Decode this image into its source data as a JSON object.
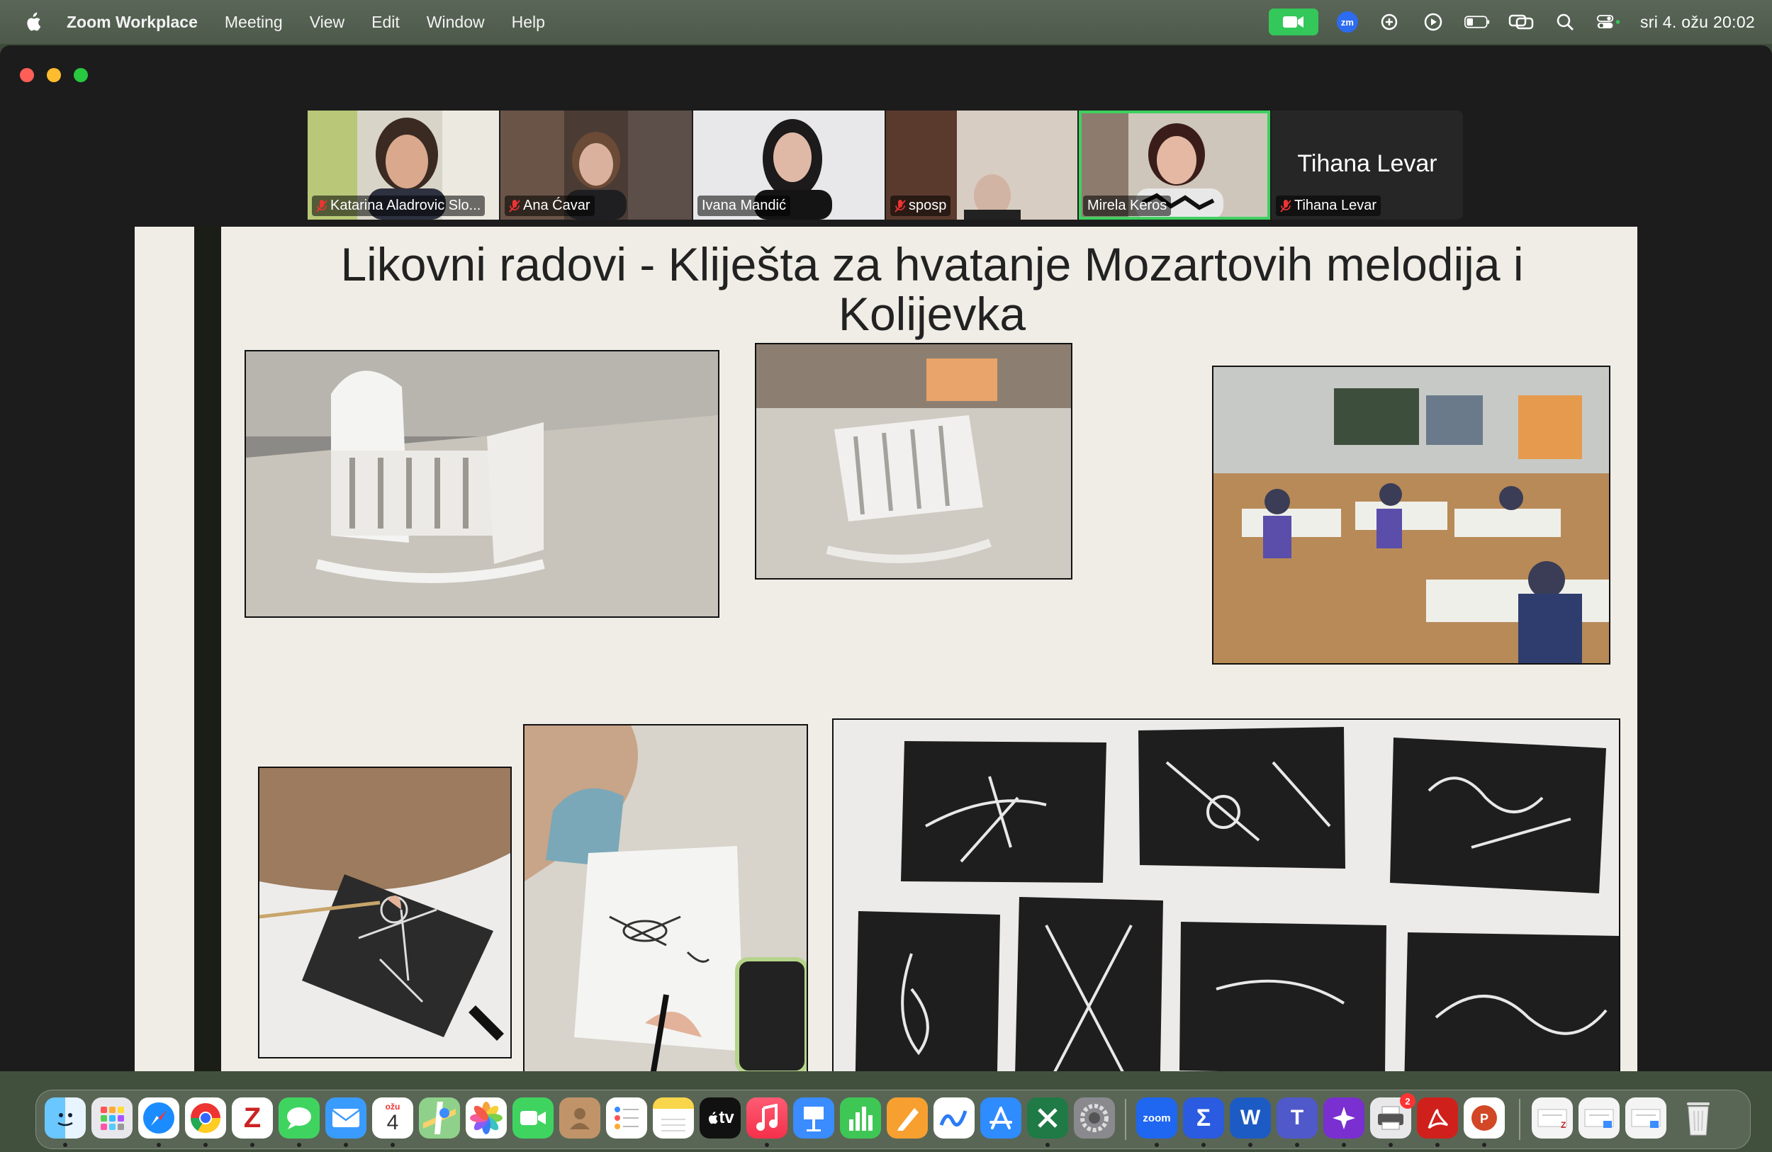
{
  "menubar": {
    "app_name": "Zoom Workplace",
    "items": [
      "Meeting",
      "View",
      "Edit",
      "Window",
      "Help"
    ],
    "clock": "sri 4. ožu  20:02",
    "zoom_badge": "zm",
    "status_icons": [
      "zoom-camera-icon",
      "zoom-app-icon",
      "spotlight-cloud-icon",
      "play-icon",
      "battery-icon",
      "screen-mirroring-icon",
      "search-icon",
      "control-center-icon"
    ]
  },
  "window": {
    "accent": "#3fd060"
  },
  "participants": [
    {
      "name": "Katarina Aladrovic Slo...",
      "muted": true,
      "has_video": true
    },
    {
      "name": "Ana Ćavar",
      "muted": true,
      "has_video": true
    },
    {
      "name": "Ivana Mandić",
      "muted": false,
      "has_video": true
    },
    {
      "name": "sposp",
      "muted": true,
      "has_video": true
    },
    {
      "name": "Mirela Keros",
      "muted": false,
      "has_video": true,
      "active_speaker": true
    },
    {
      "name": "Tihana Levar",
      "muted": true,
      "has_video": false,
      "display_name": "Tihana Levar"
    }
  ],
  "slide": {
    "title_line1": "Likovni radovi - Kliješta za hvatanje Mozartovih melodija i",
    "title_line2": "Kolijevka",
    "photos": [
      "paper-cradle-photo-1",
      "paper-cradle-photo-2",
      "classroom-photo",
      "student-drawing-photo-1",
      "student-drawing-photo-2",
      "artworks-collage-photo"
    ]
  },
  "dock": {
    "calendar_month": "ožu",
    "calendar_day": "4",
    "tv_label": "tv",
    "zoom_label": "zoom",
    "printer_badge": "2",
    "apps": [
      "finder",
      "launchpad",
      "safari",
      "chrome",
      "zotero",
      "messages",
      "mail",
      "calendar",
      "maps",
      "photos",
      "facetime",
      "contacts",
      "reminders",
      "notes",
      "apple-tv",
      "music",
      "keynote",
      "numbers",
      "pages",
      "freeform",
      "app-store",
      "excel",
      "system-settings",
      "zoom",
      "sigma",
      "word",
      "teams",
      "perplexity",
      "printer",
      "acrobat",
      "powerpoint",
      "downloads-1",
      "downloads-2",
      "downloads-3",
      "trash"
    ]
  }
}
